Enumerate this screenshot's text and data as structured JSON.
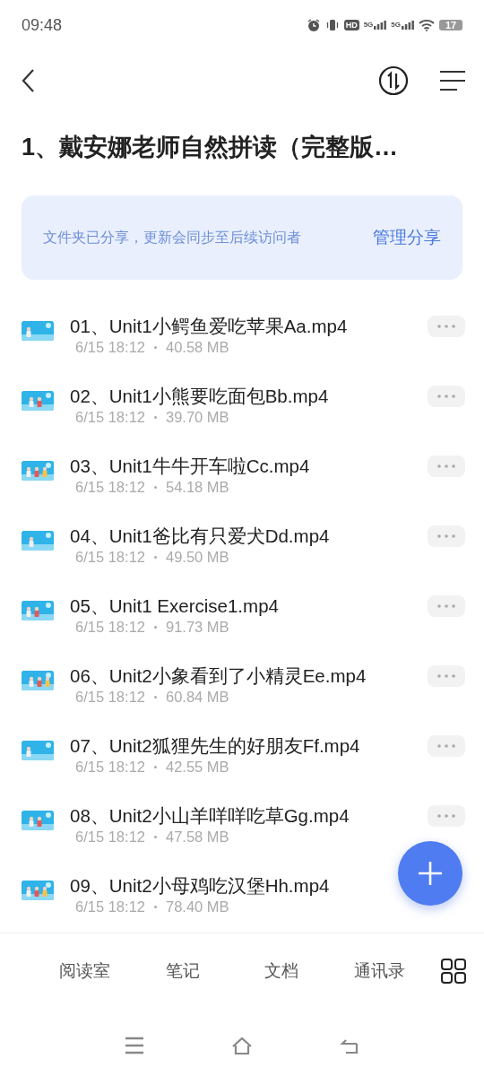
{
  "status_bar": {
    "time": "09:48",
    "hd": "HD",
    "signals": [
      "5G",
      "5G"
    ],
    "battery": "17"
  },
  "header": {
    "title": "1、戴安娜老师自然拼读（完整版…"
  },
  "share_banner": {
    "text": "文件夹已分享，更新会同步至后续访问者",
    "action": "管理分享"
  },
  "files": [
    {
      "name": "01、Unit1小鳄鱼爱吃苹果Aa.mp4",
      "date": "6/15 18:12",
      "size": "40.58 MB",
      "more_button": true
    },
    {
      "name": "02、Unit1小熊要吃面包Bb.mp4",
      "date": "6/15 18:12",
      "size": "39.70 MB",
      "more_button": true
    },
    {
      "name": "03、Unit1牛牛开车啦Cc.mp4",
      "date": "6/15 18:12",
      "size": "54.18 MB",
      "more_button": true
    },
    {
      "name": "04、Unit1爸比有只爱犬Dd.mp4",
      "date": "6/15 18:12",
      "size": "49.50 MB",
      "more_button": true
    },
    {
      "name": "05、Unit1 Exercise1.mp4",
      "date": "6/15 18:12",
      "size": "91.73 MB",
      "more_button": true
    },
    {
      "name": "06、Unit2小象看到了小精灵Ee.mp4",
      "date": "6/15 18:12",
      "size": "60.84 MB",
      "more_button": true
    },
    {
      "name": "07、Unit2狐狸先生的好朋友Ff.mp4",
      "date": "6/15 18:12",
      "size": "42.55 MB",
      "more_button": true
    },
    {
      "name": "08、Unit2小山羊咩咩吃草Gg.mp4",
      "date": "6/15 18:12",
      "size": "47.58 MB",
      "more_button": true
    },
    {
      "name": "09、Unit2小母鸡吃汉堡Hh.mp4",
      "date": "6/15 18:12",
      "size": "78.40 MB",
      "more_button": false
    }
  ],
  "bottom_tabs": [
    "阅读室",
    "笔记",
    "文档",
    "通讯录"
  ]
}
